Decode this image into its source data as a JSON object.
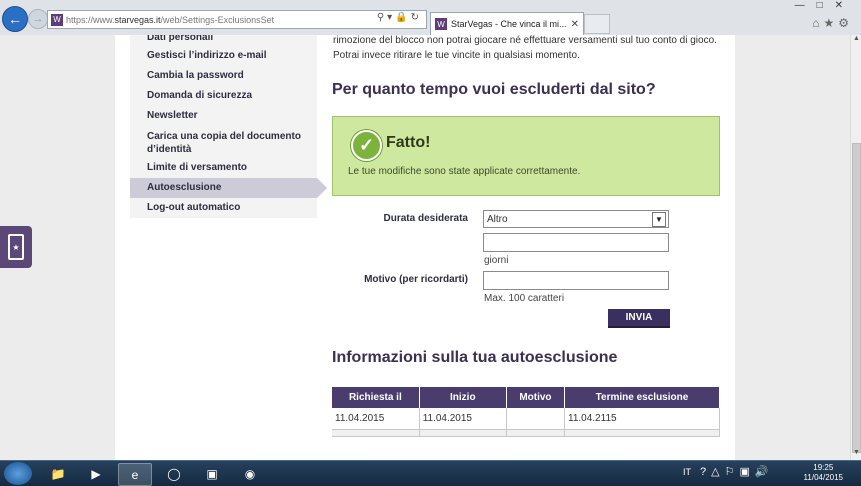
{
  "browser": {
    "url_prefix": "https://www.",
    "url_domain": "starvegas.it",
    "url_path": "/web/Settings-ExclusionsSet",
    "tab_title": "StarVegas - Che vinca il mi...",
    "favicon_letter": "W"
  },
  "sidebar": {
    "items": [
      {
        "label": "Dati personali"
      },
      {
        "label": "Gestisci l’indirizzo e-mail"
      },
      {
        "label": "Cambia la password"
      },
      {
        "label": "Domanda di sicurezza"
      },
      {
        "label": "Newsletter"
      },
      {
        "label": "Carica una copia del documento d’identità"
      },
      {
        "label": "Limite di versamento"
      },
      {
        "label": "Autoesclusione"
      },
      {
        "label": "Log-out automatico"
      }
    ],
    "active_index": 7
  },
  "intro": {
    "text": "rimozione del blocco non potrai giocare né effettuare versamenti sul tuo conto di gioco. Potrai invece ritirare le tue vincite in qualsiasi momento."
  },
  "question": {
    "heading": "Per quanto tempo vuoi escluderti dal sito?"
  },
  "success": {
    "title": "Fatto!",
    "message": "Le tue modifiche sono state applicate correttamente."
  },
  "form": {
    "duration_label": "Durata desiderata",
    "duration_value": "Altro",
    "days_value": "",
    "days_hint": "giorni",
    "reason_label": "Motivo (per ricordarti)",
    "reason_value": "",
    "reason_hint": "Max. 100 caratteri",
    "submit_label": "INVIA"
  },
  "info": {
    "heading": "Informazioni sulla tua autoesclusione",
    "columns": [
      "Richiesta il",
      "Inizio",
      "Motivo",
      "Termine esclusione"
    ],
    "rows": [
      [
        "11.04.2015",
        "11.04.2015",
        "",
        "11.04.2115"
      ]
    ]
  },
  "taskbar": {
    "language": "IT",
    "time": "19:25",
    "date": "11/04/2015"
  },
  "colors": {
    "brand_purple": "#4a3d6e",
    "success_bg": "#cfe8a0",
    "active_sidebar": "#cdcbd8"
  }
}
